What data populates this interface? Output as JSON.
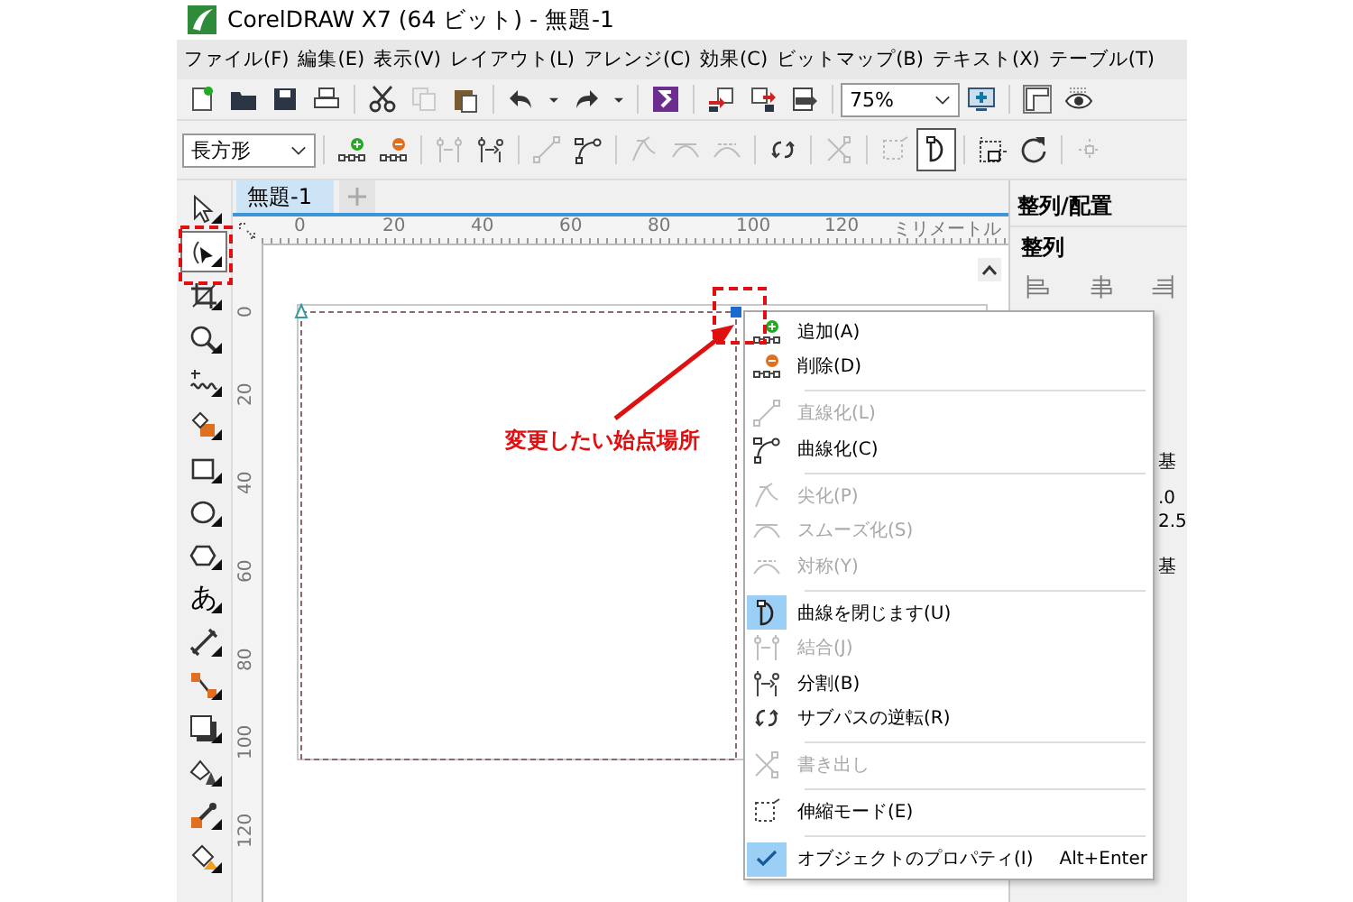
{
  "window": {
    "title": "CorelDRAW X7 (64 ビット) - 無題-1"
  },
  "menubar": [
    {
      "label": "ファイル(F)"
    },
    {
      "label": "編集(E)"
    },
    {
      "label": "表示(V)"
    },
    {
      "label": "レイアウト(L)"
    },
    {
      "label": "アレンジ(C)"
    },
    {
      "label": "効果(C)"
    },
    {
      "label": "ビットマップ(B)"
    },
    {
      "label": "テキスト(X)"
    },
    {
      "label": "テーブル(T)"
    }
  ],
  "toolbars": [
    {
      "items": [
        {
          "kind": "new",
          "disabled": false
        },
        {
          "kind": "open",
          "disabled": false
        },
        {
          "kind": "save",
          "disabled": false
        },
        {
          "kind": "print",
          "disabled": false
        },
        {
          "kind": "separator"
        },
        {
          "kind": "cut",
          "disabled": false
        },
        {
          "kind": "copy",
          "disabled": true
        },
        {
          "kind": "paste",
          "disabled": false
        },
        {
          "kind": "separator"
        },
        {
          "kind": "undo",
          "disabled": false
        },
        {
          "kind": "caret",
          "disabled": false
        },
        {
          "kind": "redo",
          "disabled": false
        },
        {
          "kind": "caret",
          "disabled": false
        },
        {
          "kind": "separator"
        },
        {
          "kind": "launcher",
          "disabled": false
        },
        {
          "kind": "separator"
        },
        {
          "kind": "import",
          "disabled": false
        },
        {
          "kind": "export",
          "disabled": false
        },
        {
          "kind": "pdf",
          "disabled": false
        },
        {
          "kind": "separator"
        },
        {
          "kind": "combo",
          "value": "75%"
        },
        {
          "kind": "fit",
          "disabled": false
        },
        {
          "kind": "separator"
        },
        {
          "kind": "rulers",
          "disabled": false
        },
        {
          "kind": "view",
          "disabled": false
        }
      ]
    },
    {
      "items": [
        {
          "kind": "combo",
          "value": "長方形"
        },
        {
          "kind": "separator"
        },
        {
          "kind": "add-node",
          "disabled": false,
          "pressed": false
        },
        {
          "kind": "delete-node",
          "disabled": false,
          "pressed": false
        },
        {
          "kind": "separator"
        },
        {
          "kind": "join",
          "disabled": true,
          "pressed": false
        },
        {
          "kind": "break",
          "disabled": false,
          "pressed": false
        },
        {
          "kind": "separator"
        },
        {
          "kind": "to-line",
          "disabled": true,
          "pressed": false
        },
        {
          "kind": "to-curve",
          "disabled": false,
          "pressed": false
        },
        {
          "kind": "separator"
        },
        {
          "kind": "cusp",
          "disabled": true,
          "pressed": false
        },
        {
          "kind": "smooth",
          "disabled": true,
          "pressed": false
        },
        {
          "kind": "symmetric",
          "disabled": true,
          "pressed": false
        },
        {
          "kind": "separator"
        },
        {
          "kind": "reverse",
          "disabled": false,
          "pressed": false
        },
        {
          "kind": "separator"
        },
        {
          "kind": "extract",
          "disabled": true,
          "pressed": false
        },
        {
          "kind": "separator"
        },
        {
          "kind": "stretch",
          "disabled": true,
          "pressed": false
        },
        {
          "kind": "close-curve",
          "disabled": false,
          "pressed": true
        },
        {
          "kind": "separator"
        },
        {
          "kind": "scale",
          "disabled": false,
          "pressed": false
        },
        {
          "kind": "rotate",
          "disabled": false,
          "pressed": false
        },
        {
          "kind": "separator"
        },
        {
          "kind": "align",
          "disabled": true,
          "pressed": false
        }
      ]
    }
  ],
  "toolbox": [
    {
      "kind": "pick",
      "selected": false
    },
    {
      "kind": "shape",
      "selected": true
    },
    {
      "kind": "crop",
      "selected": false
    },
    {
      "kind": "zoom",
      "selected": false
    },
    {
      "kind": "freehand",
      "selected": false
    },
    {
      "kind": "smart-fill",
      "selected": false
    },
    {
      "kind": "rectangle",
      "selected": false
    },
    {
      "kind": "ellipse",
      "selected": false
    },
    {
      "kind": "polygon",
      "selected": false
    },
    {
      "kind": "text",
      "label": "あ",
      "selected": false
    },
    {
      "kind": "dimension",
      "selected": false
    },
    {
      "kind": "connector",
      "selected": false
    },
    {
      "kind": "shadow",
      "selected": false
    },
    {
      "kind": "transparency",
      "selected": false
    },
    {
      "kind": "eyedropper",
      "selected": false
    },
    {
      "kind": "fill",
      "selected": false
    }
  ],
  "document_tabs": [
    {
      "label": "無題-1",
      "selected": true
    }
  ],
  "rulers": {
    "unit": "ミリメートル",
    "horizontal": [
      "0",
      "20",
      "40",
      "60",
      "80",
      "100",
      "120"
    ],
    "vertical": [
      "0",
      "20",
      "40",
      "60",
      "80",
      "100",
      "120"
    ]
  },
  "docker": {
    "title": "整列/配置",
    "section": "整列",
    "fragments": [
      "基",
      ".0",
      "2.5",
      "基"
    ]
  },
  "context_menu": {
    "items": [
      {
        "kind": "add-node",
        "label": "追加(A)",
        "disabled": false,
        "checked": false
      },
      {
        "kind": "delete-node",
        "label": "削除(D)",
        "disabled": false,
        "checked": false
      },
      {
        "kind": "separator"
      },
      {
        "kind": "to-line",
        "label": "直線化(L)",
        "disabled": true,
        "checked": false
      },
      {
        "kind": "to-curve",
        "label": "曲線化(C)",
        "disabled": false,
        "checked": false
      },
      {
        "kind": "separator"
      },
      {
        "kind": "cusp",
        "label": "尖化(P)",
        "disabled": true,
        "checked": false
      },
      {
        "kind": "smooth",
        "label": "スムーズ化(S)",
        "disabled": true,
        "checked": false
      },
      {
        "kind": "symmetric",
        "label": "対称(Y)",
        "disabled": true,
        "checked": false
      },
      {
        "kind": "separator"
      },
      {
        "kind": "close-curve",
        "label": "曲線を閉じます(U)",
        "disabled": false,
        "checked": true
      },
      {
        "kind": "join",
        "label": "結合(J)",
        "disabled": true,
        "checked": false
      },
      {
        "kind": "break",
        "label": "分割(B)",
        "disabled": false,
        "checked": false
      },
      {
        "kind": "reverse",
        "label": "サブパスの逆転(R)",
        "disabled": false,
        "checked": false
      },
      {
        "kind": "separator"
      },
      {
        "kind": "extract",
        "label": "書き出し",
        "disabled": true,
        "checked": false
      },
      {
        "kind": "separator"
      },
      {
        "kind": "stretch",
        "label": "伸縮モード(E)",
        "disabled": false,
        "checked": false
      },
      {
        "kind": "separator"
      },
      {
        "kind": "check",
        "label": "オブジェクトのプロパティ(I)",
        "shortcut": "Alt+Enter",
        "disabled": false,
        "checked": true
      }
    ]
  },
  "annotation": {
    "text": "変更したい始点場所"
  }
}
